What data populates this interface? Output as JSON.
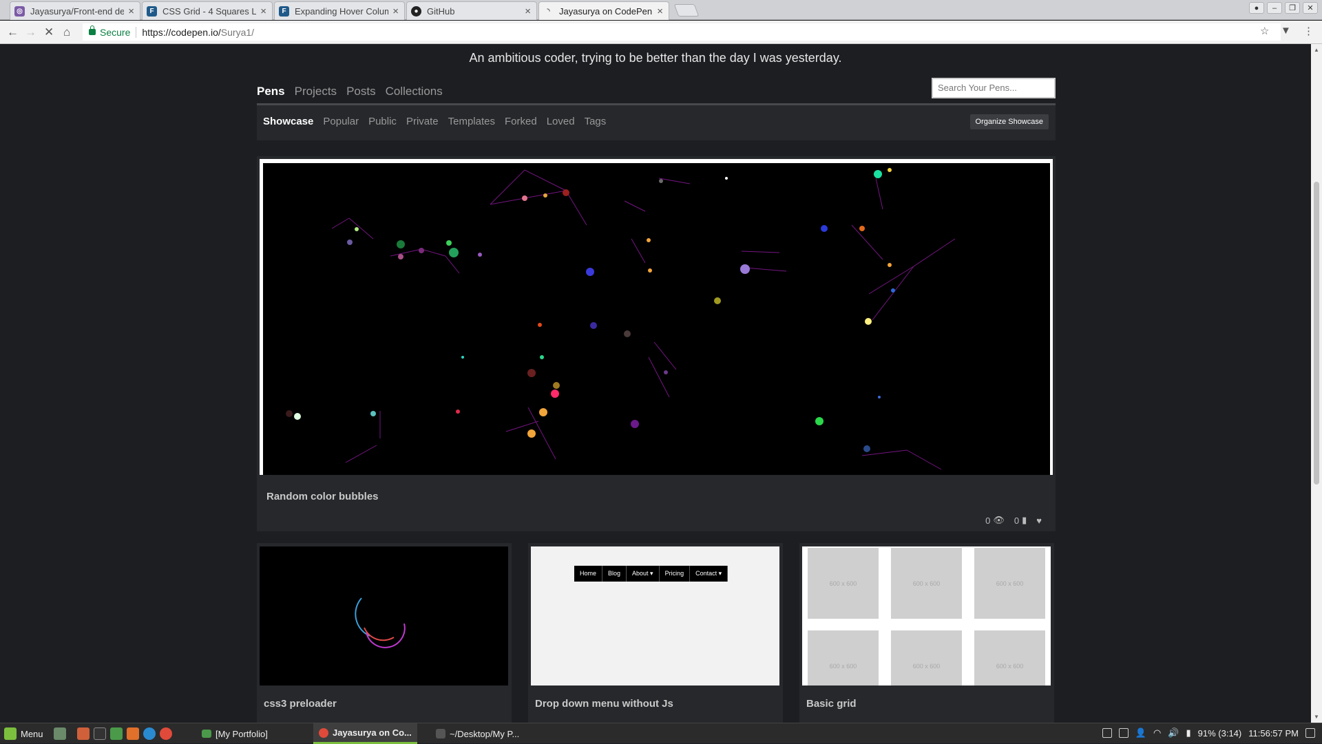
{
  "browser": {
    "tabs": [
      {
        "title": "Jayasurya/Front-end de",
        "icon": "github-icon",
        "active": false
      },
      {
        "title": "CSS Grid - 4 Squares La",
        "icon": "f-icon",
        "active": false
      },
      {
        "title": "Expanding Hover Colum",
        "icon": "f-icon",
        "active": false
      },
      {
        "title": "GitHub",
        "icon": "github-icon",
        "active": false
      },
      {
        "title": "Jayasurya on CodePen",
        "icon": "loading-icon",
        "active": true
      }
    ],
    "secure_label": "Secure",
    "url_host": "https://codepen.io/",
    "url_path": "Surya1/"
  },
  "profile": {
    "tagline": "An ambitious coder, trying to be better than the day I was yesterday."
  },
  "main_nav": [
    "Pens",
    "Projects",
    "Posts",
    "Collections"
  ],
  "search": {
    "placeholder": "Search Your Pens..."
  },
  "sub_nav": [
    "Showcase",
    "Popular",
    "Public",
    "Private",
    "Templates",
    "Forked",
    "Loved",
    "Tags"
  ],
  "organize_button": "Organize Showcase",
  "featured": {
    "title": "Random color bubbles",
    "views": "0",
    "comments": "0"
  },
  "pens": [
    {
      "title": "css3 preloader"
    },
    {
      "title": "Drop down menu without Js",
      "menu": [
        "Home",
        "Blog",
        "About ▾",
        "Pricing",
        "Contact ▾"
      ]
    },
    {
      "title": "Basic grid",
      "placeholder": "600 x 600"
    }
  ],
  "taskbar": {
    "menu_label": "Menu",
    "windows": [
      "[My Portfolio]",
      "Jayasurya on Co...",
      "~/Desktop/My P..."
    ],
    "battery": "91% (3:14)",
    "clock": "11:56:57 PM"
  }
}
